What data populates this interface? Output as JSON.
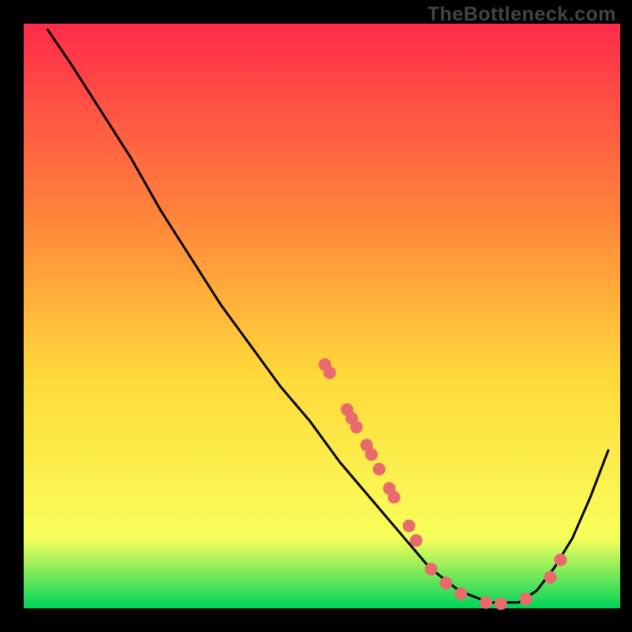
{
  "watermark": "TheBottleneck.com",
  "chart_data": {
    "type": "line",
    "title": "",
    "xlabel": "",
    "ylabel": "",
    "xlim": [
      0,
      100
    ],
    "ylim": [
      0,
      100
    ],
    "curve": [
      {
        "x": 4,
        "y": 99
      },
      {
        "x": 8,
        "y": 93
      },
      {
        "x": 13,
        "y": 85
      },
      {
        "x": 18,
        "y": 77
      },
      {
        "x": 23,
        "y": 68
      },
      {
        "x": 28,
        "y": 60
      },
      {
        "x": 33,
        "y": 52
      },
      {
        "x": 38,
        "y": 45
      },
      {
        "x": 43,
        "y": 38
      },
      {
        "x": 48,
        "y": 32
      },
      {
        "x": 53,
        "y": 25
      },
      {
        "x": 58,
        "y": 19
      },
      {
        "x": 63,
        "y": 13
      },
      {
        "x": 68,
        "y": 7
      },
      {
        "x": 73,
        "y": 3
      },
      {
        "x": 78,
        "y": 1
      },
      {
        "x": 83,
        "y": 1
      },
      {
        "x": 86,
        "y": 3
      },
      {
        "x": 89,
        "y": 7
      },
      {
        "x": 92,
        "y": 12
      },
      {
        "x": 95,
        "y": 19
      },
      {
        "x": 98,
        "y": 27
      }
    ],
    "points": [
      {
        "x": 50.5,
        "y": 41.7
      },
      {
        "x": 51.3,
        "y": 40.3
      },
      {
        "x": 54.2,
        "y": 34.0
      },
      {
        "x": 55.0,
        "y": 32.5
      },
      {
        "x": 55.8,
        "y": 31.0
      },
      {
        "x": 57.5,
        "y": 27.9
      },
      {
        "x": 58.3,
        "y": 26.3
      },
      {
        "x": 59.6,
        "y": 23.8
      },
      {
        "x": 61.3,
        "y": 20.5
      },
      {
        "x": 62.1,
        "y": 19.0
      },
      {
        "x": 64.6,
        "y": 14.1
      },
      {
        "x": 65.8,
        "y": 11.6
      },
      {
        "x": 68.3,
        "y": 6.7
      },
      {
        "x": 70.8,
        "y": 4.3
      },
      {
        "x": 73.3,
        "y": 2.5
      },
      {
        "x": 77.5,
        "y": 1.0
      },
      {
        "x": 80.0,
        "y": 0.8
      },
      {
        "x": 84.2,
        "y": 1.6
      },
      {
        "x": 88.3,
        "y": 5.3
      },
      {
        "x": 90.0,
        "y": 8.3
      }
    ],
    "gradient": {
      "top": "#ff2b4a",
      "mid1": "#ff8a3a",
      "mid2": "#ffd83a",
      "mid3": "#f8ff5a",
      "bottom": "#00d45a"
    },
    "point_color": "#e86a6a",
    "curve_color": "#000000"
  }
}
